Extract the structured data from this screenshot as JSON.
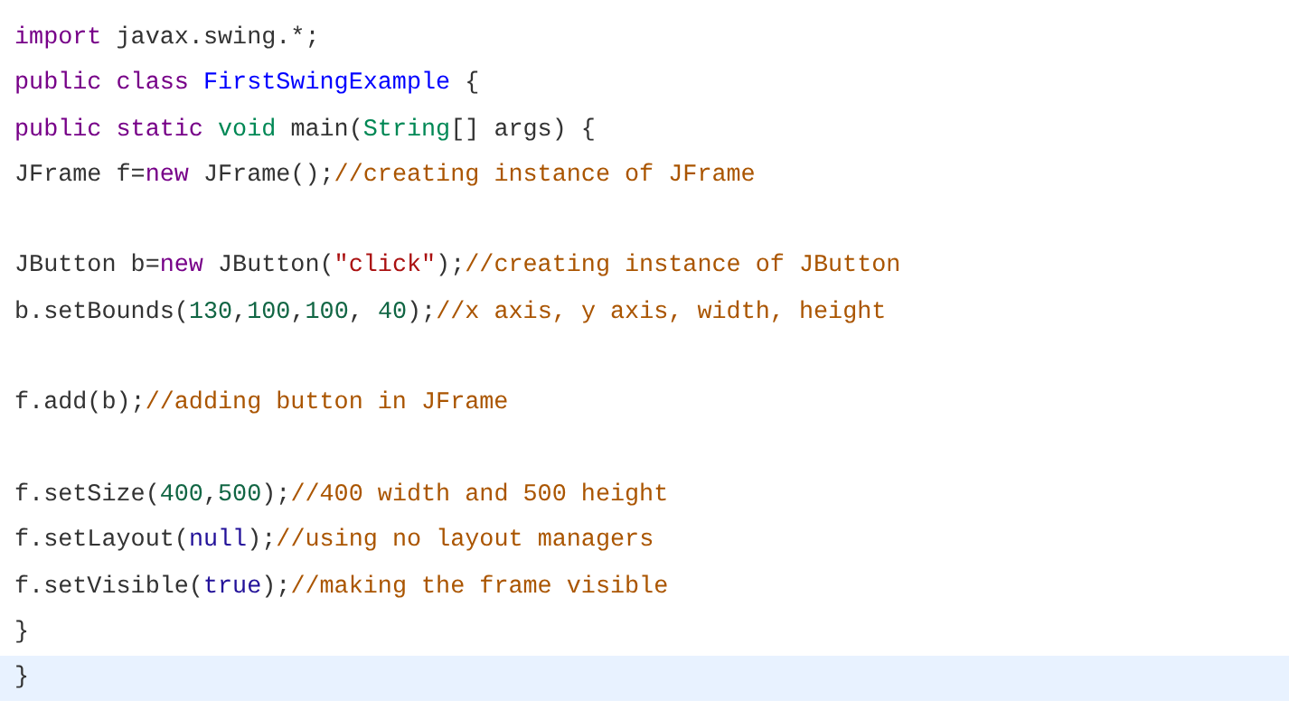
{
  "code_lines": [
    {
      "kind": "code",
      "highlighted": false,
      "tokens": [
        {
          "kind": "keyword",
          "text": "import"
        },
        {
          "kind": "plain",
          "text": " javax.swing.*;"
        }
      ]
    },
    {
      "kind": "code",
      "highlighted": false,
      "tokens": [
        {
          "kind": "keyword",
          "text": "public class "
        },
        {
          "kind": "def",
          "text": "FirstSwingExample"
        },
        {
          "kind": "plain",
          "text": " {"
        }
      ]
    },
    {
      "kind": "code",
      "highlighted": false,
      "tokens": [
        {
          "kind": "keyword",
          "text": "public static "
        },
        {
          "kind": "type",
          "text": "void"
        },
        {
          "kind": "plain",
          "text": " main("
        },
        {
          "kind": "type",
          "text": "String"
        },
        {
          "kind": "plain",
          "text": "[] args) {"
        }
      ]
    },
    {
      "kind": "code",
      "highlighted": false,
      "tokens": [
        {
          "kind": "plain",
          "text": "JFrame f="
        },
        {
          "kind": "keyword",
          "text": "new"
        },
        {
          "kind": "plain",
          "text": " JFrame();"
        },
        {
          "kind": "comment",
          "text": "//creating instance of JFrame"
        }
      ]
    },
    {
      "kind": "blank"
    },
    {
      "kind": "code",
      "highlighted": false,
      "tokens": [
        {
          "kind": "plain",
          "text": "JButton b="
        },
        {
          "kind": "keyword",
          "text": "new"
        },
        {
          "kind": "plain",
          "text": " JButton("
        },
        {
          "kind": "string",
          "text": "\"click\""
        },
        {
          "kind": "plain",
          "text": ");"
        },
        {
          "kind": "comment",
          "text": "//creating instance of JButton"
        }
      ]
    },
    {
      "kind": "code",
      "highlighted": false,
      "tokens": [
        {
          "kind": "plain",
          "text": "b.setBounds("
        },
        {
          "kind": "number",
          "text": "130"
        },
        {
          "kind": "plain",
          "text": ","
        },
        {
          "kind": "number",
          "text": "100"
        },
        {
          "kind": "plain",
          "text": ","
        },
        {
          "kind": "number",
          "text": "100"
        },
        {
          "kind": "plain",
          "text": ", "
        },
        {
          "kind": "number",
          "text": "40"
        },
        {
          "kind": "plain",
          "text": ");"
        },
        {
          "kind": "comment",
          "text": "//x axis, y axis, width, height"
        }
      ]
    },
    {
      "kind": "blank"
    },
    {
      "kind": "code",
      "highlighted": false,
      "tokens": [
        {
          "kind": "plain",
          "text": "f.add(b);"
        },
        {
          "kind": "comment",
          "text": "//adding button in JFrame"
        }
      ]
    },
    {
      "kind": "blank"
    },
    {
      "kind": "code",
      "highlighted": false,
      "tokens": [
        {
          "kind": "plain",
          "text": "f.setSize("
        },
        {
          "kind": "number",
          "text": "400"
        },
        {
          "kind": "plain",
          "text": ","
        },
        {
          "kind": "number",
          "text": "500"
        },
        {
          "kind": "plain",
          "text": ");"
        },
        {
          "kind": "comment",
          "text": "//400 width and 500 height"
        }
      ]
    },
    {
      "kind": "code",
      "highlighted": false,
      "tokens": [
        {
          "kind": "plain",
          "text": "f.setLayout("
        },
        {
          "kind": "atom",
          "text": "null"
        },
        {
          "kind": "plain",
          "text": ");"
        },
        {
          "kind": "comment",
          "text": "//using no layout managers"
        }
      ]
    },
    {
      "kind": "code",
      "highlighted": false,
      "tokens": [
        {
          "kind": "plain",
          "text": "f.setVisible("
        },
        {
          "kind": "atom",
          "text": "true"
        },
        {
          "kind": "plain",
          "text": ");"
        },
        {
          "kind": "comment",
          "text": "//making the frame visible"
        }
      ]
    },
    {
      "kind": "code",
      "highlighted": false,
      "tokens": [
        {
          "kind": "plain",
          "text": "}"
        }
      ]
    },
    {
      "kind": "code",
      "highlighted": true,
      "tokens": [
        {
          "kind": "plain",
          "text": "}"
        }
      ]
    }
  ]
}
